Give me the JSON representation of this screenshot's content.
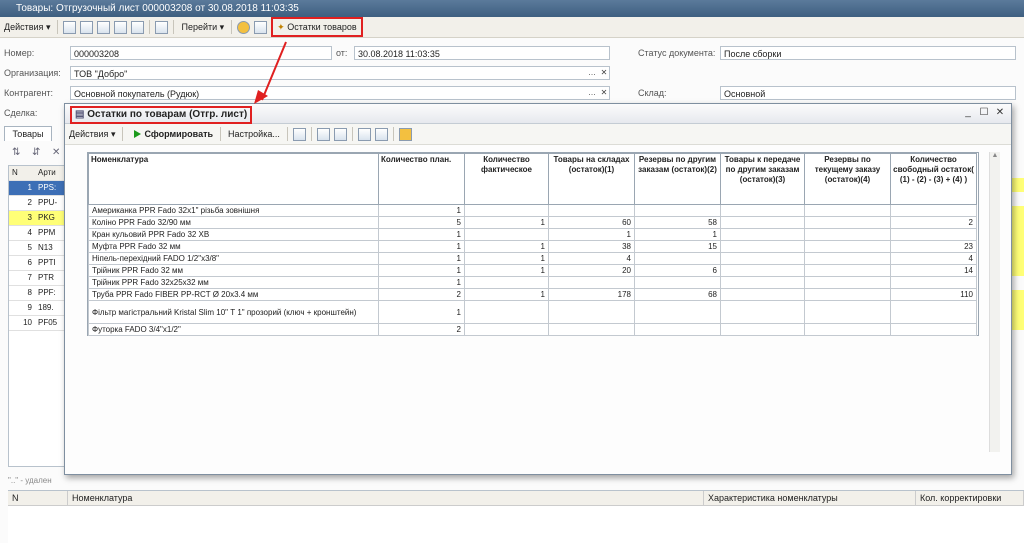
{
  "window": {
    "title": "Товары: Отгрузочный лист 000003208 от 30.08.2018 11:03:35"
  },
  "toolbar": {
    "actions": "Действия",
    "goto": "Перейти",
    "stock_button": "Остатки товаров"
  },
  "form": {
    "number_label": "Номер:",
    "number": "000003208",
    "date_label": "от:",
    "date": "30.08.2018 11:03:35",
    "status_label": "Статус документа:",
    "status": "После сборки",
    "org_label": "Организация:",
    "org": "ТОВ \"Добро\"",
    "contractor_label": "Контрагент:",
    "contractor": "Основной покупатель (Рудюк)",
    "warehouse_label": "Склад:",
    "warehouse": "Основной",
    "deal_label": "Сделка:"
  },
  "tabs": {
    "goods": "Товары"
  },
  "left_grid": {
    "col_n": "N",
    "col_art": "Арти",
    "rows": [
      {
        "n": "1",
        "a": "PPS:"
      },
      {
        "n": "2",
        "a": "PPU-"
      },
      {
        "n": "3",
        "a": "PKG"
      },
      {
        "n": "4",
        "a": "PPM"
      },
      {
        "n": "5",
        "a": "N13"
      },
      {
        "n": "6",
        "a": "PPTI"
      },
      {
        "n": "7",
        "a": "PTR"
      },
      {
        "n": "8",
        "a": "PPF:"
      },
      {
        "n": "9",
        "a": "189."
      },
      {
        "n": "10",
        "a": "PF05"
      }
    ]
  },
  "footnote": "\"..\" - удален",
  "bottom_grid": {
    "col_n": "N",
    "col_nom": "Номенклатура",
    "col_char": "Характеристика номенклатуры",
    "col_qty": "Кол. корректировки"
  },
  "dialog": {
    "title": "Остатки по товарам (Отгр. лист)",
    "actions": "Действия",
    "run": "Сформировать",
    "settings": "Настройка...",
    "columns": [
      "Номенклатура",
      "Количество план.",
      "Количество фактическое",
      "Товары на складах (остаток)(1)",
      "Резервы по другим заказам (остаток)(2)",
      "Товары к передаче по другим заказам (остаток)(3)",
      "Резервы по текущему заказу (остаток)(4)",
      "Количество свободный остаток( (1) - (2) - (3) + (4) )"
    ],
    "rows": [
      [
        "Американка PPR Fado 32x1\" різьба зовнішня",
        "1",
        "",
        "",
        "",
        "",
        "",
        ""
      ],
      [
        "Коліно PPR Fado 32/90 мм",
        "5",
        "1",
        "60",
        "58",
        "",
        "",
        "2"
      ],
      [
        "Кран кульовий PPR Fado 32 ХВ",
        "1",
        "",
        "1",
        "1",
        "",
        "",
        ""
      ],
      [
        "Муфта PPR Fado 32 мм",
        "1",
        "1",
        "38",
        "15",
        "",
        "",
        "23"
      ],
      [
        "Ніпель-перехідний FADO 1/2\"x3/8\"",
        "1",
        "1",
        "4",
        "",
        "",
        "",
        "4"
      ],
      [
        "Трійник PPR Fado 32 мм",
        "1",
        "1",
        "20",
        "6",
        "",
        "",
        "14"
      ],
      [
        "Трійник PPR Fado 32x25x32 мм",
        "1",
        "",
        "",
        "",
        "",
        "",
        ""
      ],
      [
        "Труба PPR Fado FIBER PP-RCT Ø 20x3.4 мм",
        "2",
        "1",
        "178",
        "68",
        "",
        "",
        "110"
      ],
      [
        "Фільтр магістральний Kristal Slim 10\" Т 1\" прозорий (ключ + кронштейн)",
        "1",
        "",
        "",
        "",
        "",
        "",
        ""
      ],
      [
        "Футорка FADO 3/4\"x1/2\"",
        "2",
        "",
        "",
        "",
        "",
        "",
        ""
      ]
    ]
  },
  "colors": {
    "highlight": "#e02020",
    "yellow": "#ffff77",
    "title_bar": "#4a6a8c",
    "selected_row": "#3d6fb6"
  }
}
